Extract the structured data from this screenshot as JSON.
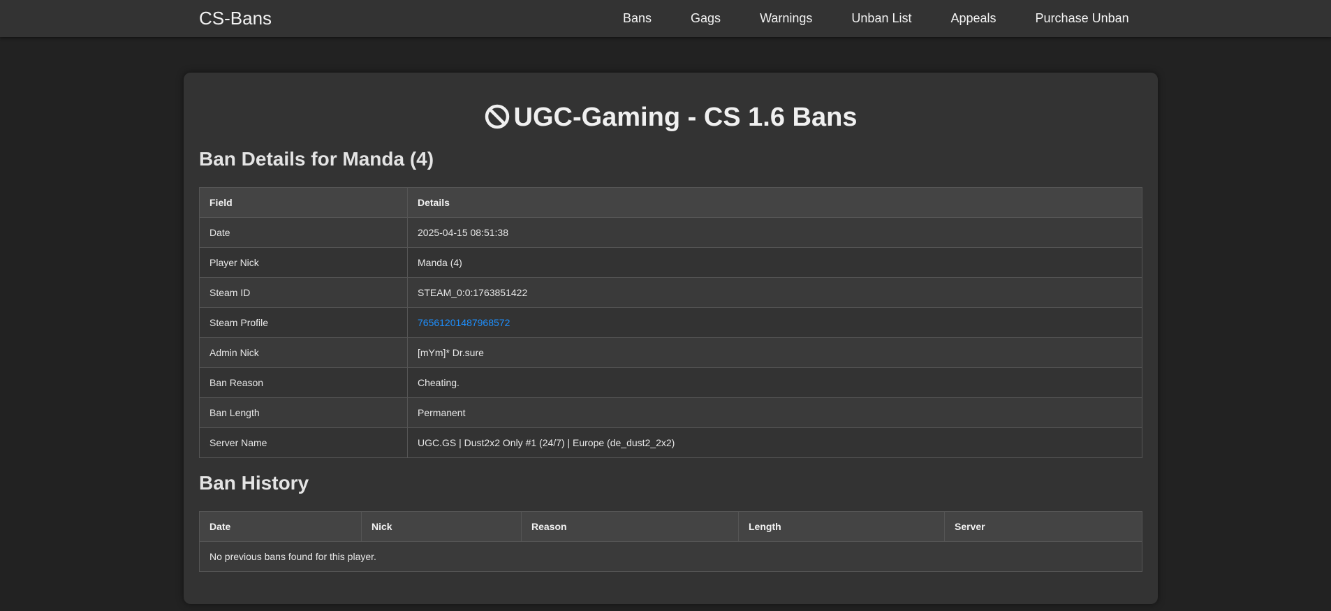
{
  "navbar": {
    "brand": "CS-Bans",
    "links": [
      "Bans",
      "Gags",
      "Warnings",
      "Unban List",
      "Appeals",
      "Purchase Unban"
    ]
  },
  "page": {
    "title": "UGC-Gaming - CS 1.6 Bans",
    "title_icon": "ban-icon"
  },
  "ban_details": {
    "heading": "Ban Details for Manda (4)",
    "columns": [
      "Field",
      "Details"
    ],
    "rows": [
      {
        "field": "Date",
        "value": "2025-04-15 08:51:38"
      },
      {
        "field": "Player Nick",
        "value": "Manda (4)"
      },
      {
        "field": "Steam ID",
        "value": "STEAM_0:0:1763851422"
      },
      {
        "field": "Steam Profile",
        "value": "76561201487968572"
      },
      {
        "field": "Admin Nick",
        "value": "[mYm]* Dr.sure"
      },
      {
        "field": "Ban Reason",
        "value": "Cheating."
      },
      {
        "field": "Ban Length",
        "value": "Permanent"
      },
      {
        "field": "Server Name",
        "value": "UGC.GS | Dust2x2 Only #1 (24/7) | Europe (de_dust2_2x2)"
      }
    ]
  },
  "ban_history": {
    "heading": "Ban History",
    "columns": [
      "Date",
      "Nick",
      "Reason",
      "Length",
      "Server"
    ],
    "empty_message": "No previous bans found for this player."
  },
  "colors": {
    "background": "#222222",
    "navbar": "#333333",
    "card": "#333333",
    "table_header": "#444444",
    "link": "#1e90ff"
  }
}
